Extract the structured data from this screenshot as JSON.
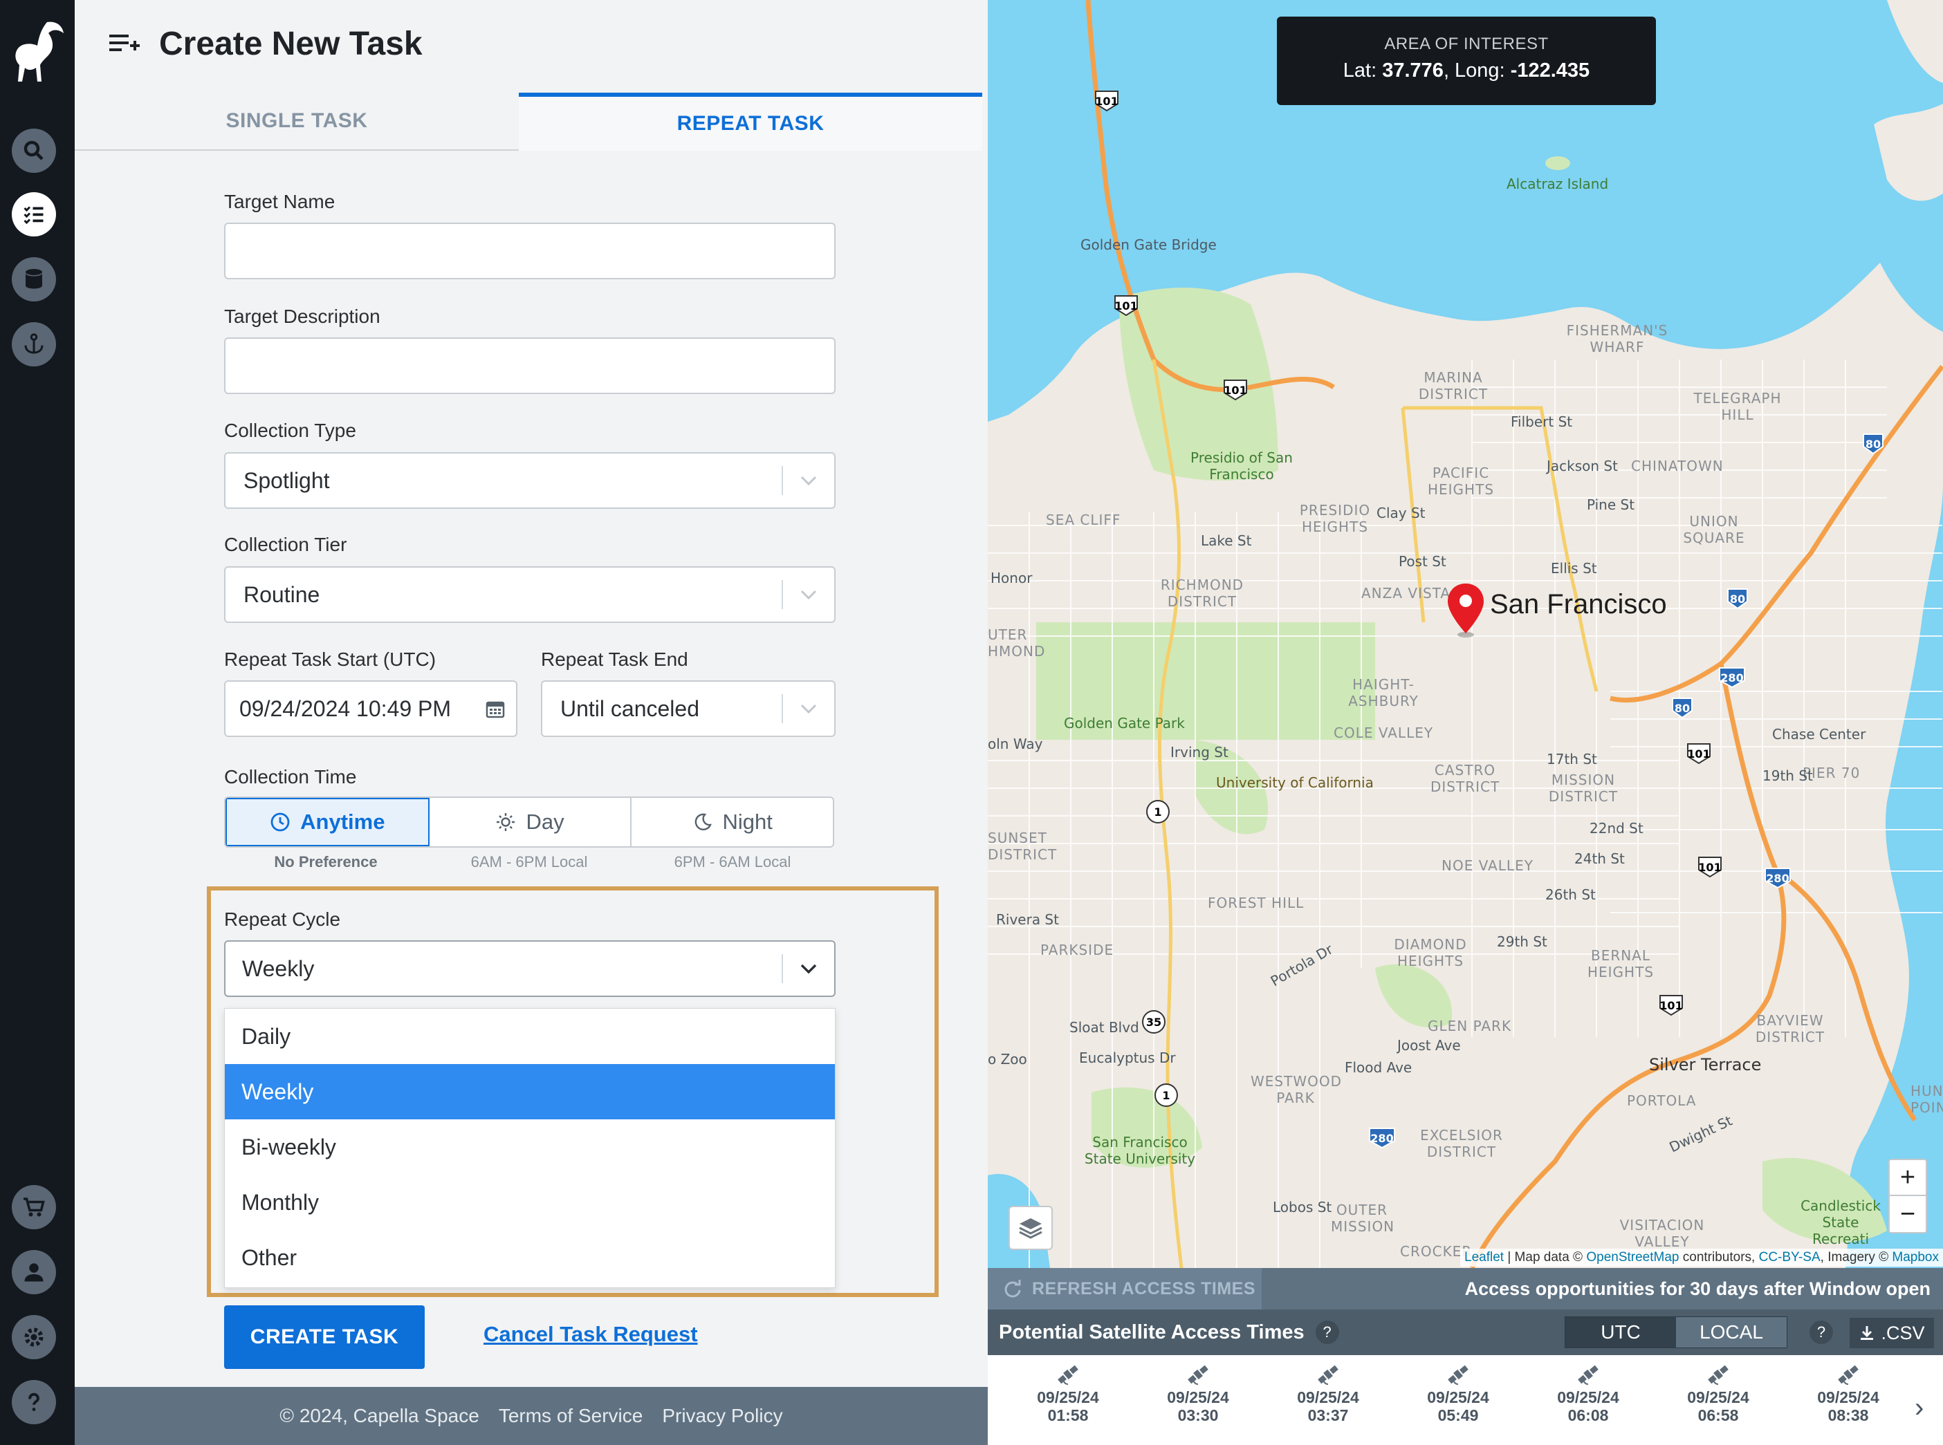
{
  "form": {
    "title": "Create New Task",
    "tabs": [
      {
        "label": "SINGLE TASK",
        "active": false
      },
      {
        "label": "REPEAT TASK",
        "active": true
      }
    ],
    "target_name": {
      "label": "Target Name",
      "value": ""
    },
    "target_description": {
      "label": "Target Description",
      "value": ""
    },
    "collection_type": {
      "label": "Collection Type",
      "value": "Spotlight"
    },
    "collection_tier": {
      "label": "Collection Tier",
      "value": "Routine"
    },
    "repeat_start": {
      "label": "Repeat Task Start (UTC)",
      "value": "09/24/2024 10:49 PM"
    },
    "repeat_end": {
      "label": "Repeat Task End",
      "value": "Until canceled"
    },
    "collection_time": {
      "label": "Collection Time",
      "options": [
        {
          "label": "Anytime",
          "sub": "No Preference",
          "active": true
        },
        {
          "label": "Day",
          "sub": "6AM - 6PM Local",
          "active": false
        },
        {
          "label": "Night",
          "sub": "6PM - 6AM Local",
          "active": false
        }
      ]
    },
    "repeat_cycle": {
      "label": "Repeat Cycle",
      "value": "Weekly",
      "options": [
        "Daily",
        "Weekly",
        "Bi-weekly",
        "Monthly",
        "Other"
      ],
      "selected": "Weekly"
    },
    "create_button": "CREATE TASK",
    "cancel_link": "Cancel Task Request"
  },
  "footer": {
    "copyright": "© 2024, Capella Space",
    "terms": "Terms of Service",
    "privacy": "Privacy Policy"
  },
  "map": {
    "aoi": {
      "caption": "AREA OF INTEREST",
      "lat_label": "Lat:",
      "lat": "37.776",
      "long_label": ", Long:",
      "long": "-122.435"
    },
    "city_label": "San Francisco",
    "labels": {
      "alcatraz": "Alcatraz Island",
      "golden_gate_bridge": "Golden Gate Bridge",
      "fishermans_wharf": "FISHERMAN'S WHARF",
      "marina": "MARINA DISTRICT",
      "telegraph_hill": "TELEGRAPH HILL",
      "presidio": "Presidio of San Francisco",
      "pacific_heights": "PACIFIC HEIGHTS",
      "chinatown": "CHINATOWN",
      "presidio_heights": "PRESIDIO HEIGHTS",
      "union_square": "UNION SQUARE",
      "sea_cliff": "SEA CLIFF",
      "richmond": "RICHMOND DISTRICT",
      "anza_vista": "ANZA VISTA",
      "haight": "HAIGHT-ASHBURY",
      "golden_gate_park": "Golden Gate Park",
      "cole_valley": "COLE VALLEY",
      "ucsf": "University of California",
      "castro": "CASTRO DISTRICT",
      "mission": "MISSION DISTRICT",
      "chase_center": "Chase Center",
      "pier70": "PIER 70",
      "sunset": "SUNSET DISTRICT",
      "noe_valley": "NOE VALLEY",
      "forest_hill": "FOREST HILL",
      "parkside": "PARKSIDE",
      "diamond_heights": "DIAMOND HEIGHTS",
      "bernal_heights": "BERNAL HEIGHTS",
      "glen_park": "GLEN PARK",
      "bayview": "BAYVIEW DISTRICT",
      "silver_terrace": "Silver Terrace",
      "westwood_park": "WESTWOOD PARK",
      "portola": "PORTOLA",
      "sfsu": "San Francisco State University",
      "excelsior": "EXCELSIOR DISTRICT",
      "outer_mission": "OUTER MISSION",
      "visitacion_valley": "VISITACION VALLEY",
      "candlestick": "Candlestick State Recreati",
      "hunters_point": "HUNT POIN",
      "zoo": "o Zoo",
      "sloat": "Sloat Blvd",
      "eucalyptus": "Eucalyptus Dr",
      "portola_dr": "Portola Dr",
      "lake_st": "Lake St",
      "post_st": "Post St",
      "ellis_st": "Ellis St",
      "clay_st": "Clay St",
      "pine_st": "Pine St",
      "jackson_st": "Jackson St",
      "filbert_st": "Filbert St",
      "irving_st": "Irving St",
      "lincoln_way": "oln Way",
      "rivera_st": "Rivera St",
      "joost_ave": "Joost Ave",
      "flood_ave": "Flood Ave",
      "lobos_st": "Lobos St",
      "17th_st": "17th St",
      "19th_st": "19th St",
      "22nd_st": "22nd St",
      "24th_st": "24th St",
      "26th_st": "26th St",
      "29th_st": "29th St",
      "dwight_st": "Dwight St",
      "honor": "Honor",
      "outer_richmond": "UTER HMOND",
      "crocker": "CROCKER"
    },
    "route_shields": [
      "101",
      "101",
      "101",
      "101",
      "101",
      "101",
      "80",
      "80",
      "80",
      "280",
      "280",
      "280",
      "1",
      "1",
      "1",
      "35"
    ],
    "zoom_in": "+",
    "zoom_out": "−",
    "attribution": {
      "leaflet": "Leaflet",
      "text1": " | Map data © ",
      "osm": "OpenStreetMap",
      "text2": " contributors, ",
      "ccbysa": "CC-BY-SA",
      "text3": ", Imagery © ",
      "mapbox": "Mapbox"
    }
  },
  "access": {
    "refresh_label": "REFRESH ACCESS TIMES",
    "note": "Access opportunities for 30 days after Window open",
    "title": "Potential Satellite Access Times",
    "help": "?",
    "tz_options": [
      "UTC",
      "LOCAL"
    ],
    "tz_active": "UTC",
    "csv_label": ".CSV",
    "times": [
      {
        "date": "09/25/24",
        "time": "01:58"
      },
      {
        "date": "09/25/24",
        "time": "03:30"
      },
      {
        "date": "09/25/24",
        "time": "03:37"
      },
      {
        "date": "09/25/24",
        "time": "05:49"
      },
      {
        "date": "09/25/24",
        "time": "06:08"
      },
      {
        "date": "09/25/24",
        "time": "06:58"
      },
      {
        "date": "09/25/24",
        "time": "08:38"
      }
    ]
  },
  "colors": {
    "accent": "#0d6fd8",
    "highlight_border": "#d4a055",
    "rail": "#141920",
    "footer": "#607282",
    "water": "#7fd3f3",
    "park": "#cfe8b8"
  }
}
